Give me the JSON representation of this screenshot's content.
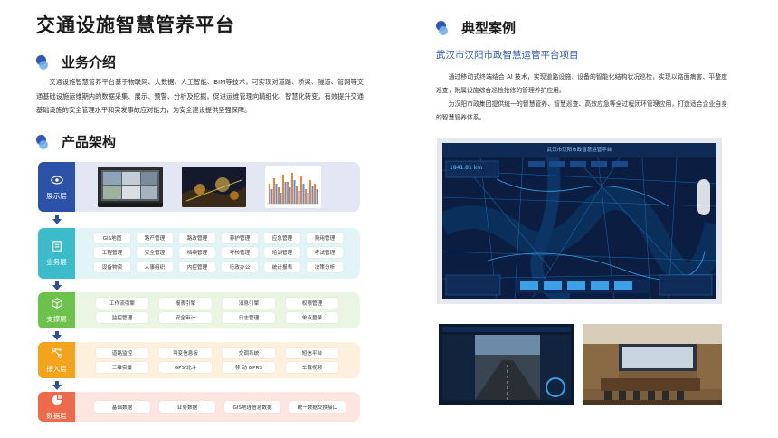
{
  "page": {
    "title": "交通设施智慧管养平台"
  },
  "business": {
    "title": "业务介绍",
    "text": "交通设施智慧管养平台基于物联网、大数据、人工智能、BIM等技术，可实现对道路、桥梁、隧道、管网等交通基础设施运维期内的数据采集、展示、预警、分析及挖掘，促进运维管理向精细化、智慧化转变，有效提升交通基础设施的安全管理水平和突发事故应对能力，为安全建设提供坚强保障。"
  },
  "architecture": {
    "title": "产品架构",
    "layers": [
      {
        "label": "展示层",
        "chips": []
      },
      {
        "label": "业务层",
        "chips": [
          "GIS地图",
          "路产管理",
          "路政管理",
          "养护管理",
          "应急管理",
          "费用管理",
          "工程管理",
          "安全管理",
          "档案管理",
          "考核管理",
          "培训管理",
          "考试管理",
          "设备物资",
          "人事组织",
          "内控管理",
          "行政办公",
          "统计报表",
          "决策分析"
        ]
      },
      {
        "label": "支撑层",
        "chips": [
          "工作流引擎",
          "报表引擎",
          "消息引擎",
          "权限管理",
          "监控管理",
          "安全审计",
          "日志管理",
          "单点登录"
        ]
      },
      {
        "label": "接入层",
        "chips": [
          "道路监控",
          "可变信息板",
          "交调系统",
          "短信平台",
          "三维实景",
          "GPS/北斗",
          "移 动 GPRS",
          "车载视频"
        ]
      },
      {
        "label": "数据层",
        "chips": [
          "基础数据",
          "业务数据",
          "GIS地理信息数据",
          "统一数据交换接口"
        ]
      }
    ]
  },
  "cases": {
    "title": "典型案例",
    "project_title": "武汉市汉阳市政智慧运管平台项目",
    "para1": "通过移动式终端结合 AI 技术，实现道路设施、设备的智能化结构状况巡检，实现以路面病害、平整度巡查，附属设施综合巡检抢修的管理养护应用。",
    "para2": "为汉阳市政集团提供统一的智慧管养、智慧巡查、高效应急等全过程闭环管理应用，打造适合企业自身的智慧管养体系。",
    "screen_title": "武汉市汉阳市政智慧运管平台",
    "screen_value": "1841.81 km"
  },
  "colors": {
    "display": "#2c51a8",
    "business": "#3cbccb",
    "support": "#6cc24a",
    "access": "#f4a41c",
    "data": "#ef6a4a"
  },
  "icons": {
    "display": "eye-icon",
    "business": "document-icon",
    "support": "cube-icon",
    "access": "network-icon",
    "data": "pie-chart-icon"
  }
}
